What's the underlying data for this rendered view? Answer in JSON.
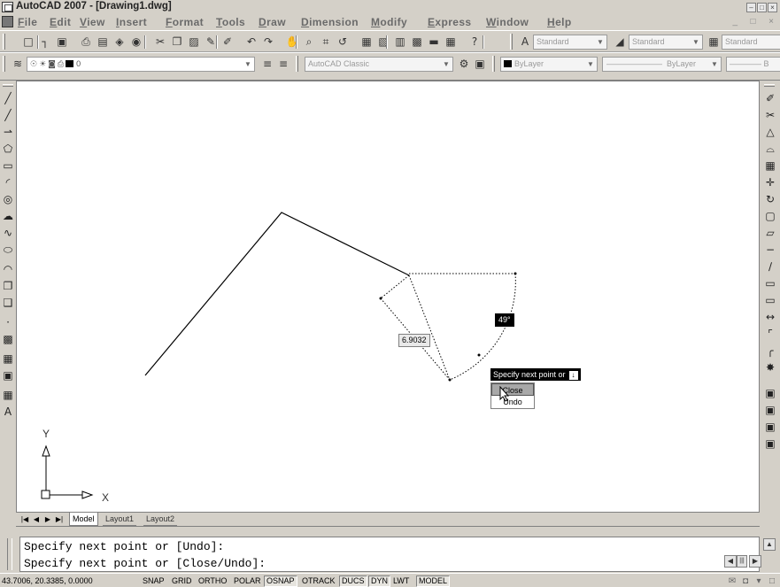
{
  "window": {
    "title": "AutoCAD 2007 - [Drawing1.dwg]",
    "minimize_glyph": "–",
    "maximize_glyph": "□",
    "close_glyph": "×",
    "doc_controls": "_  □  ×"
  },
  "menu": {
    "items": [
      {
        "label": "File"
      },
      {
        "label": "Edit"
      },
      {
        "label": "View"
      },
      {
        "label": "Insert"
      },
      {
        "label": "Format"
      },
      {
        "label": "Tools"
      },
      {
        "label": "Draw"
      },
      {
        "label": "Dimension"
      },
      {
        "label": "Modify"
      },
      {
        "label": "Express"
      },
      {
        "label": "Window"
      },
      {
        "label": "Help"
      }
    ]
  },
  "toolbars": {
    "standard_icons": [
      {
        "name": "new-icon",
        "glyph": "□"
      },
      {
        "name": "open-icon",
        "glyph": "┐"
      },
      {
        "name": "save-icon",
        "glyph": "▣"
      },
      {
        "name": "plot-icon",
        "glyph": "⎙"
      },
      {
        "name": "plot-preview-icon",
        "glyph": "▤"
      },
      {
        "name": "publish-icon",
        "glyph": "◈"
      },
      {
        "name": "3d-dwf-icon",
        "glyph": "◉"
      },
      {
        "name": "cut-icon",
        "glyph": "✂"
      },
      {
        "name": "copy-icon",
        "glyph": "❐"
      },
      {
        "name": "paste-icon",
        "glyph": "▨"
      },
      {
        "name": "match-properties-icon",
        "glyph": "✎"
      },
      {
        "name": "block-editor-icon",
        "glyph": "✐"
      },
      {
        "name": "undo-icon",
        "glyph": "↶"
      },
      {
        "name": "redo-icon",
        "glyph": "↷"
      },
      {
        "name": "pan-icon",
        "glyph": "✋"
      },
      {
        "name": "zoom-realtime-icon",
        "glyph": "⌕"
      },
      {
        "name": "zoom-window-icon",
        "glyph": "⌗"
      },
      {
        "name": "zoom-previous-icon",
        "glyph": "↺"
      },
      {
        "name": "properties-icon",
        "glyph": "▦"
      },
      {
        "name": "design-center-icon",
        "glyph": "▧"
      },
      {
        "name": "tool-palettes-icon",
        "glyph": "▥"
      },
      {
        "name": "sheet-set-icon",
        "glyph": "▩"
      },
      {
        "name": "markup-icon",
        "glyph": "▬"
      },
      {
        "name": "calculator-icon",
        "glyph": "▦"
      },
      {
        "name": "help-icon",
        "glyph": "?"
      }
    ],
    "text_style_value": "Standard",
    "dim_style_value": "Standard",
    "table_style_value": "Standard",
    "layer_value": "0",
    "workspace_value": "AutoCAD Classic",
    "color_value": "ByLayer",
    "linetype_value": "ByLayer",
    "lineweight_value": "B",
    "layer_state_icons": [
      {
        "name": "layer-on-icon",
        "glyph": "☉"
      },
      {
        "name": "layer-freeze-icon",
        "glyph": "☀"
      },
      {
        "name": "layer-lock-icon",
        "glyph": "◙"
      },
      {
        "name": "layer-plot-icon",
        "glyph": "⎙"
      }
    ],
    "layer_tool_icons": [
      {
        "name": "make-object-layer-current-icon",
        "glyph": "≡"
      },
      {
        "name": "layer-previous-icon",
        "glyph": "≡"
      }
    ],
    "workspace_tool_icons": [
      {
        "name": "workspace-settings-icon",
        "glyph": "⚙"
      },
      {
        "name": "my-workspace-icon",
        "glyph": "▣"
      }
    ]
  },
  "draw_toolbar": [
    {
      "name": "line-icon",
      "glyph": "╱"
    },
    {
      "name": "construction-line-icon",
      "glyph": "╱"
    },
    {
      "name": "polyline-icon",
      "glyph": "⇀"
    },
    {
      "name": "polygon-icon",
      "glyph": "⬠"
    },
    {
      "name": "rectangle-icon",
      "glyph": "▭"
    },
    {
      "name": "arc-icon",
      "glyph": "◜"
    },
    {
      "name": "circle-icon",
      "glyph": "◎"
    },
    {
      "name": "revision-cloud-icon",
      "glyph": "☁"
    },
    {
      "name": "spline-icon",
      "glyph": "∿"
    },
    {
      "name": "ellipse-icon",
      "glyph": "⬭"
    },
    {
      "name": "ellipse-arc-icon",
      "glyph": "◠"
    },
    {
      "name": "insert-block-icon",
      "glyph": "❐"
    },
    {
      "name": "make-block-icon",
      "glyph": "❑"
    },
    {
      "name": "point-icon",
      "glyph": "·"
    },
    {
      "name": "hatch-icon",
      "glyph": "▩"
    },
    {
      "name": "gradient-icon",
      "glyph": "▦"
    },
    {
      "name": "region-icon",
      "glyph": "▣"
    },
    {
      "name": "table-icon",
      "glyph": "▦"
    },
    {
      "name": "multiline-text-icon",
      "glyph": "A"
    }
  ],
  "modify_toolbar": [
    {
      "name": "erase-icon",
      "glyph": "✐"
    },
    {
      "name": "copy-object-icon",
      "glyph": "✂"
    },
    {
      "name": "mirror-icon",
      "glyph": "△"
    },
    {
      "name": "offset-icon",
      "glyph": "⌓"
    },
    {
      "name": "array-icon",
      "glyph": "▦"
    },
    {
      "name": "move-icon",
      "glyph": "✛"
    },
    {
      "name": "rotate-icon",
      "glyph": "↻"
    },
    {
      "name": "scale-icon",
      "glyph": "▢"
    },
    {
      "name": "stretch-icon",
      "glyph": "▱"
    },
    {
      "name": "trim-icon",
      "glyph": "−"
    },
    {
      "name": "extend-icon",
      "glyph": "∕"
    },
    {
      "name": "break-at-point-icon",
      "glyph": "▭"
    },
    {
      "name": "break-icon",
      "glyph": "▭"
    },
    {
      "name": "join-icon",
      "glyph": "↔"
    },
    {
      "name": "chamfer-icon",
      "glyph": "⌜"
    },
    {
      "name": "fillet-icon",
      "glyph": "╭"
    },
    {
      "name": "explode-icon",
      "glyph": "✸"
    }
  ],
  "draw_order_toolbar": [
    {
      "name": "bring-to-front-icon",
      "glyph": "▣"
    },
    {
      "name": "send-to-back-icon",
      "glyph": "▣"
    },
    {
      "name": "bring-above-icon",
      "glyph": "▣"
    },
    {
      "name": "send-under-icon",
      "glyph": "▣"
    }
  ],
  "drawing": {
    "length_value": "6.9032",
    "angle_value": "49°",
    "dyn_prompt": "Specify next point or",
    "dyn_prompt_arrow": "↓",
    "dyn_options": [
      {
        "label": "Close"
      },
      {
        "label": "Undo"
      }
    ],
    "ucs_x_label": "X",
    "ucs_y_label": "Y"
  },
  "tabs": {
    "nav_glyphs": [
      "|◀",
      "◀",
      "▶",
      "▶|"
    ],
    "items": [
      {
        "label": "Model"
      },
      {
        "label": "Layout1"
      },
      {
        "label": "Layout2"
      }
    ]
  },
  "command": {
    "lines": [
      "Specify next point or [Undo]:",
      "Specify next point or [Close/Undo]:"
    ],
    "scroll_up": "▲",
    "scroll_left": "◀",
    "scroll_thumb": "|||",
    "scroll_right": "▶"
  },
  "status": {
    "coordinates": "43.7006, 20.3385, 0.0000",
    "buttons": [
      {
        "label": "SNAP",
        "on": false
      },
      {
        "label": "GRID",
        "on": false
      },
      {
        "label": "ORTHO",
        "on": false
      },
      {
        "label": "POLAR",
        "on": false
      },
      {
        "label": "OSNAP",
        "on": true
      },
      {
        "label": "OTRACK",
        "on": false
      },
      {
        "label": "DUCS",
        "on": true
      },
      {
        "label": "DYN",
        "on": true
      },
      {
        "label": "LWT",
        "on": false
      },
      {
        "label": "MODEL",
        "on": true
      }
    ],
    "tray_icons": [
      {
        "name": "communication-center-icon",
        "glyph": "✉"
      },
      {
        "name": "toolbar-lock-icon",
        "glyph": "◘"
      },
      {
        "name": "status-menu-icon",
        "glyph": "▾"
      },
      {
        "name": "clean-screen-icon",
        "glyph": "□"
      }
    ]
  }
}
